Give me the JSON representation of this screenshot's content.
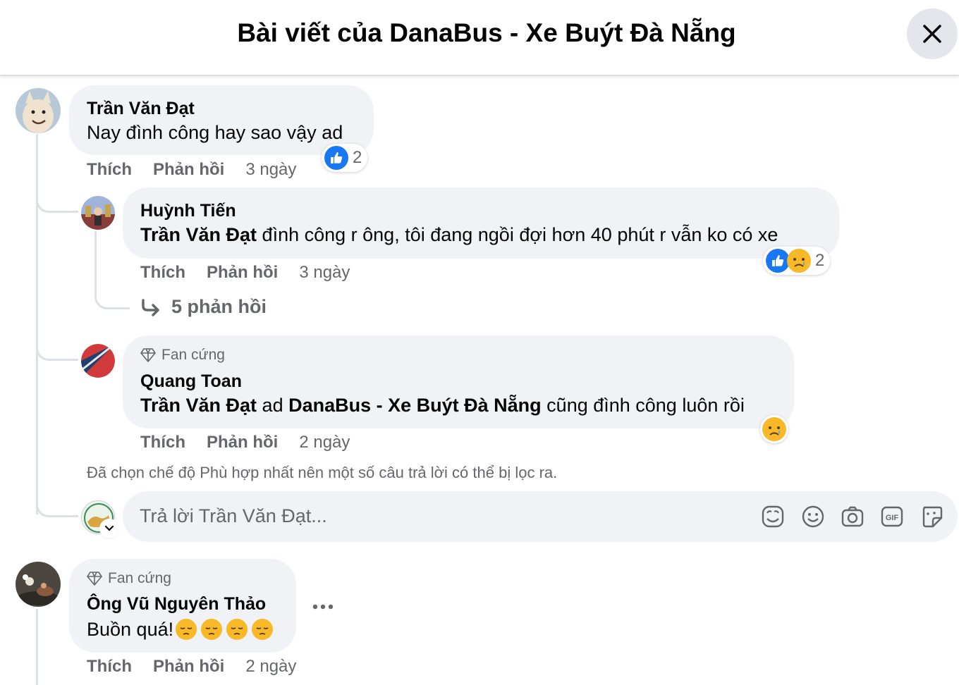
{
  "header": {
    "title": "Bài viết của DanaBus - Xe Buýt Đà Nẵng"
  },
  "comments": [
    {
      "author": "Trần Văn Đạt",
      "text": "Nay đình công hay sao vậy ad",
      "actions": {
        "like": "Thích",
        "reply": "Phản hồi",
        "time": "3 ngày"
      },
      "reactions": {
        "icons": [
          "like-icon"
        ],
        "count": "2"
      }
    },
    {
      "author": "Huỳnh Tiến",
      "mention": "Trần Văn Đạt",
      "text": " đình công r ông, tôi đang ngồi đợi hơn 40 phút r vẫn ko có xe",
      "actions": {
        "like": "Thích",
        "reply": "Phản hồi",
        "time": "3 ngày"
      },
      "reactions": {
        "icons": [
          "like-icon",
          "sad-icon"
        ],
        "count": "2"
      },
      "more_replies": "5 phản hồi"
    },
    {
      "badge": "Fan cứng",
      "author": "Quang Toan",
      "mention": "Trần Văn Đạt",
      "mid_text": " ad ",
      "mention2": "DanaBus - Xe Buýt Đà Nẵng",
      "text": " cũng đình công luôn rồi",
      "actions": {
        "like": "Thích",
        "reply": "Phản hồi",
        "time": "2 ngày"
      },
      "reactions": {
        "icons": [
          "sad-icon"
        ]
      }
    },
    {
      "badge": "Fan cứng",
      "author": "Ông Vũ Nguyên Thảo",
      "text": "Buồn quá!",
      "actions": {
        "like": "Thích",
        "reply": "Phản hồi",
        "time": "2 ngày"
      }
    }
  ],
  "filter_note": "Đã chọn chế độ Phù hợp nhất nên một số câu trả lời có thể bị lọc ra.",
  "reply_box": {
    "placeholder": "Trả lời Trần Văn Đạt...",
    "tools": [
      "avatar-sticker-icon",
      "emoji-icon",
      "camera-icon",
      "gif-icon",
      "sticker-icon"
    ]
  },
  "colors": {
    "like_blue": "#1877f2",
    "sad_yellow": "#f7b928",
    "bubble_bg": "#f0f2f5",
    "muted_text": "#65676b"
  }
}
